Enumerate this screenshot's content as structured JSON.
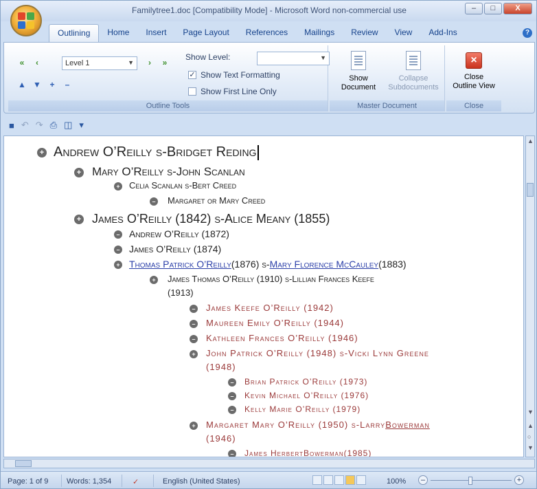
{
  "window": {
    "title": "Familytree1.doc [Compatibility Mode] - Microsoft Word non-commercial use",
    "controls": {
      "minimize": "–",
      "maximize": "□",
      "close": "X"
    }
  },
  "tabs": [
    "Outlining",
    "Home",
    "Insert",
    "Page Layout",
    "References",
    "Mailings",
    "Review",
    "View",
    "Add-Ins"
  ],
  "ribbon": {
    "outline_tools": {
      "label": "Outline Tools",
      "level_value": "Level 1",
      "show_level_label": "Show Level:",
      "show_level_value": "",
      "show_text_formatting": {
        "label": "Show Text Formatting",
        "checked": true
      },
      "show_first_line_only": {
        "label": "Show First Line Only",
        "checked": false
      }
    },
    "master_document": {
      "label": "Master Document",
      "show_document": [
        "Show",
        "Document"
      ],
      "collapse_subdocuments": [
        "Collapse",
        "Subdocuments"
      ]
    },
    "close": {
      "label": "Close",
      "close_outline_view": [
        "Close",
        "Outline View"
      ]
    }
  },
  "outline": [
    {
      "level": 0,
      "bullet": "plus",
      "segments": [
        {
          "text": "Andrew O’Reilly s-Bridget Reding",
          "style": "dark"
        }
      ],
      "cursor": true
    },
    {
      "level": 1,
      "bullet": "plus",
      "segments": [
        {
          "text": "Mary O’Reilly s-John Scanlan",
          "style": "dark"
        }
      ]
    },
    {
      "level": 2,
      "bullet": "plus",
      "segments": [
        {
          "text": "Celia Scanlan s-Bert Creed",
          "style": "dark"
        }
      ]
    },
    {
      "level": 3,
      "bullet": "minus",
      "segments": [
        {
          "text": "Margaret or Mary Creed",
          "style": "dark"
        }
      ]
    },
    {
      "level": 1,
      "bullet": "plus",
      "segments": [
        {
          "text": "James O’Reilly (1842) s-Alice Meany (1855)",
          "style": "dark"
        }
      ]
    },
    {
      "level": 2,
      "bullet": "minus",
      "segments": [
        {
          "text": "Andrew  O’Reilly (1872)",
          "style": "dark"
        }
      ]
    },
    {
      "level": 2,
      "bullet": "minus",
      "segments": [
        {
          "text": "James O’Reilly (1874)",
          "style": "dark"
        }
      ]
    },
    {
      "level": 2,
      "bullet": "plus",
      "segments": [
        {
          "text": "Thomas Patrick O’Reilly",
          "style": "link"
        },
        {
          "text": " (1876) s-",
          "style": "dark"
        },
        {
          "text": "Mary Florence McCauley",
          "style": "link"
        },
        {
          "text": " (1883)",
          "style": "dark"
        }
      ]
    },
    {
      "level": 3,
      "bullet": "plus",
      "segments": [
        {
          "text": "James Thomas O’Reilly (1910) s-Lillian Frances Keefe",
          "style": "dark"
        }
      ]
    },
    {
      "level": 3,
      "bullet": "none",
      "segments": [
        {
          "text": "(1913)",
          "style": "dark"
        }
      ]
    },
    {
      "level": 4,
      "bullet": "minus",
      "segments": [
        {
          "text": "James Keefe  O’Reilly (1942)",
          "style": "red"
        }
      ]
    },
    {
      "level": 4,
      "bullet": "minus",
      "segments": [
        {
          "text": "Maureen Emily O’Reilly (1944)",
          "style": "red"
        }
      ]
    },
    {
      "level": 4,
      "bullet": "minus",
      "segments": [
        {
          "text": "Kathleen Frances O’Reilly (1946)",
          "style": "red"
        }
      ]
    },
    {
      "level": 4,
      "bullet": "plus",
      "segments": [
        {
          "text": "John Patrick O’Reilly (1948) s-Vicki Lynn Greene",
          "style": "red"
        }
      ]
    },
    {
      "level": 4,
      "bullet": "none",
      "segments": [
        {
          "text": "(1948)",
          "style": "red"
        }
      ]
    },
    {
      "level": 5,
      "bullet": "minus",
      "segments": [
        {
          "text": "Brian Patrick O’Reilly (1973)",
          "style": "red"
        }
      ]
    },
    {
      "level": 5,
      "bullet": "minus",
      "segments": [
        {
          "text": "Kevin Michael O’Reilly (1976)",
          "style": "red"
        }
      ]
    },
    {
      "level": 5,
      "bullet": "minus",
      "segments": [
        {
          "text": "Kelly Marie O’Reilly (1979)",
          "style": "red"
        }
      ]
    },
    {
      "level": 4,
      "bullet": "plus",
      "segments": [
        {
          "text": "Margaret Mary O’Reilly (1950) s-Larry ",
          "style": "red"
        },
        {
          "text": "Bowerman",
          "style": "red-underline"
        }
      ]
    },
    {
      "level": 4,
      "bullet": "none",
      "segments": [
        {
          "text": "(1946)",
          "style": "red"
        }
      ]
    },
    {
      "level": 5,
      "bullet": "minus",
      "segments": [
        {
          "text": "James Herbert ",
          "style": "red"
        },
        {
          "text": "Bowerman",
          "style": "red-underline"
        },
        {
          "text": " (1985)",
          "style": "red"
        }
      ]
    }
  ],
  "status": {
    "page": "Page: 1 of 9",
    "words": "Words: 1,354",
    "language": "English (United States)",
    "zoom": "100%"
  },
  "colors": {
    "accent": "#15428b",
    "link": "#2b3fa8",
    "subdoc_text": "#9a3838"
  }
}
